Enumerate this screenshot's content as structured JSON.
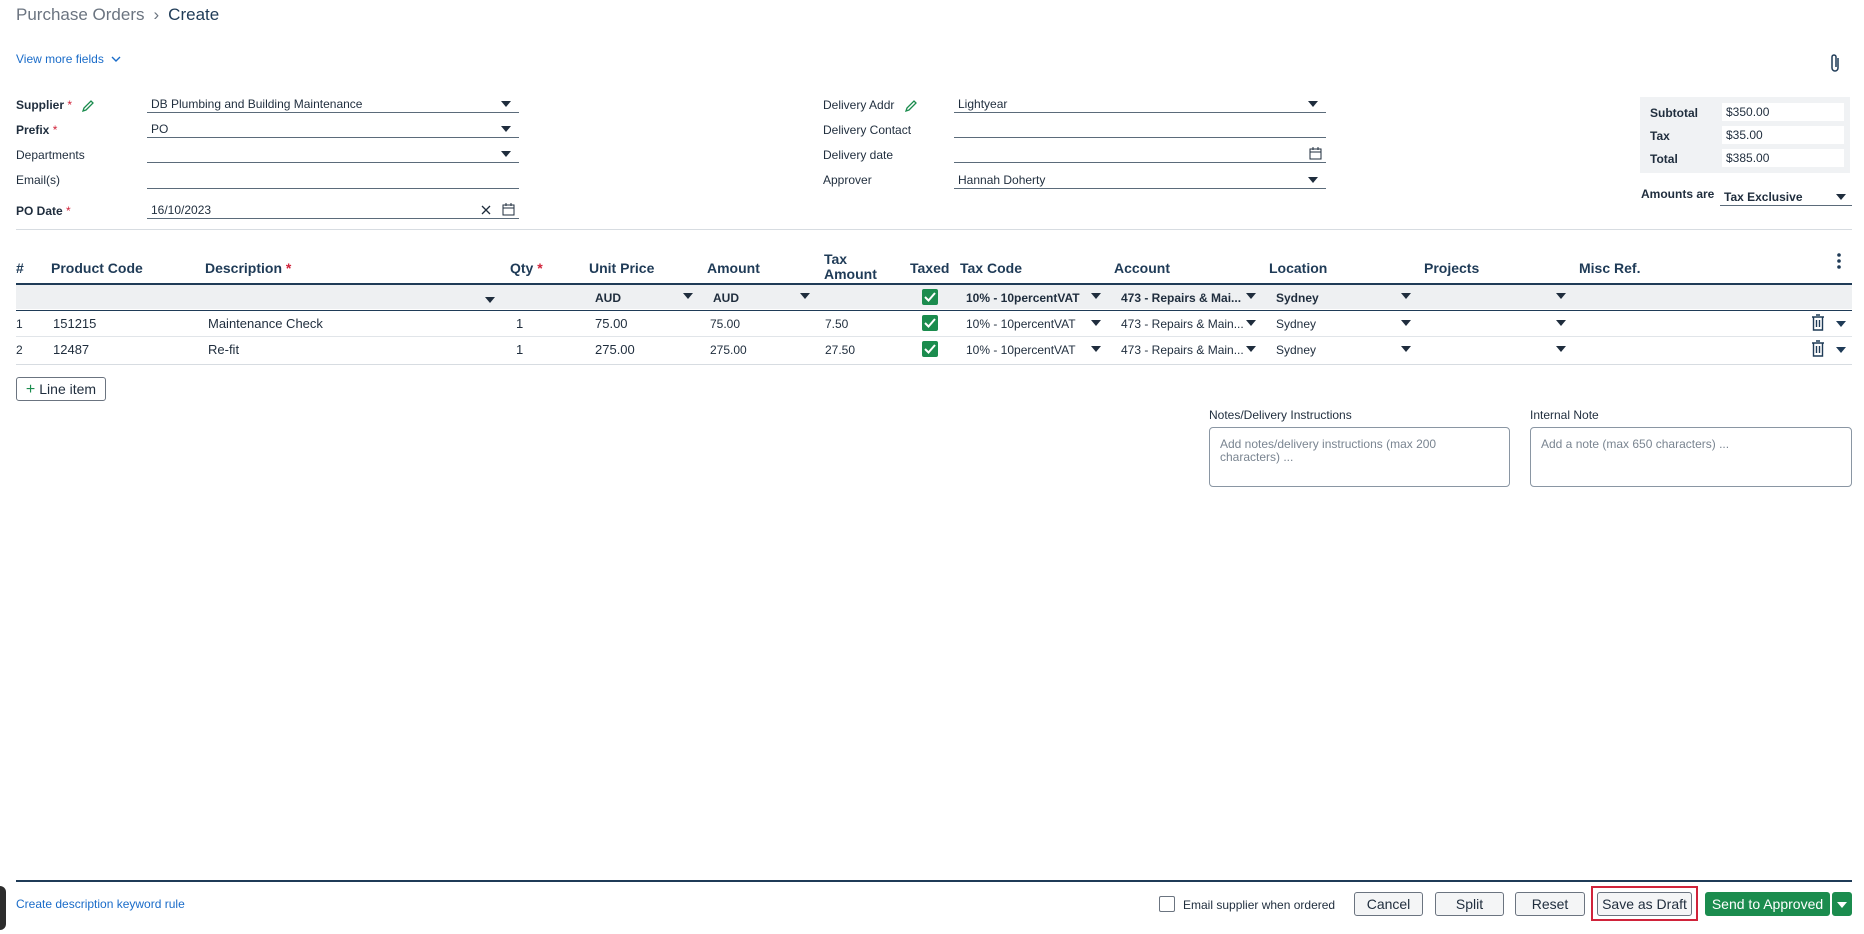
{
  "breadcrumb": {
    "parent": "Purchase Orders",
    "current": "Create"
  },
  "view_more": "View more fields",
  "form_left": {
    "supplier": {
      "label": "Supplier",
      "value": "DB Plumbing and Building Maintenance"
    },
    "prefix": {
      "label": "Prefix",
      "value": "PO"
    },
    "departments": {
      "label": "Departments",
      "value": ""
    },
    "emails": {
      "label": "Email(s)",
      "value": ""
    },
    "po_date": {
      "label": "PO Date",
      "value": "16/10/2023"
    }
  },
  "form_mid": {
    "delivery_addr": {
      "label": "Delivery Addr",
      "value": "Lightyear"
    },
    "delivery_contact": {
      "label": "Delivery Contact",
      "value": ""
    },
    "delivery_date": {
      "label": "Delivery date",
      "value": ""
    },
    "approver": {
      "label": "Approver",
      "value": "Hannah Doherty"
    }
  },
  "totals": {
    "subtotal_label": "Subtotal",
    "subtotal": "$350.00",
    "tax_label": "Tax",
    "tax": "$35.00",
    "total_label": "Total",
    "total": "$385.00",
    "amounts_are_label": "Amounts are",
    "amounts_are": "Tax Exclusive"
  },
  "table": {
    "headers": {
      "num": "#",
      "product_code": "Product Code",
      "description": "Description",
      "qty": "Qty",
      "unit_price": "Unit Price",
      "amount": "Amount",
      "tax_amount_1": "Tax",
      "tax_amount_2": "Amount",
      "taxed": "Taxed",
      "tax_code": "Tax Code",
      "account": "Account",
      "location": "Location",
      "projects": "Projects",
      "misc_ref": "Misc Ref."
    },
    "filters": {
      "unit_price": "AUD",
      "amount": "AUD",
      "tax_code": "10% - 10percentVAT",
      "account": "473 - Repairs & Mai...",
      "location": "Sydney"
    },
    "rows": [
      {
        "num": "1",
        "product_code": "151215",
        "description": "Maintenance Check",
        "qty": "1",
        "unit_price": "75.00",
        "amount": "75.00",
        "tax_amount": "7.50",
        "tax_code": "10% - 10percentVAT",
        "account": "473 - Repairs & Main...",
        "location": "Sydney"
      },
      {
        "num": "2",
        "product_code": "12487",
        "description": "Re-fit",
        "qty": "1",
        "unit_price": "275.00",
        "amount": "275.00",
        "tax_amount": "27.50",
        "tax_code": "10% - 10percentVAT",
        "account": "473 - Repairs & Main...",
        "location": "Sydney"
      }
    ]
  },
  "line_item_button": "Line item",
  "notes": {
    "delivery_label": "Notes/Delivery Instructions",
    "delivery_placeholder": "Add notes/delivery instructions (max 200 characters) ...",
    "internal_label": "Internal Note",
    "internal_placeholder": "Add a note (max 650 characters) ..."
  },
  "footer": {
    "keyword_rule_link": "Create description keyword rule",
    "email_supplier": "Email supplier when ordered",
    "cancel": "Cancel",
    "split": "Split",
    "reset": "Reset",
    "save_draft": "Save as Draft",
    "send_approved": "Send to Approved"
  },
  "colors": {
    "accent_green": "#1b8c4e",
    "link_blue": "#1a6cc9",
    "highlight_red": "#d0233a"
  }
}
